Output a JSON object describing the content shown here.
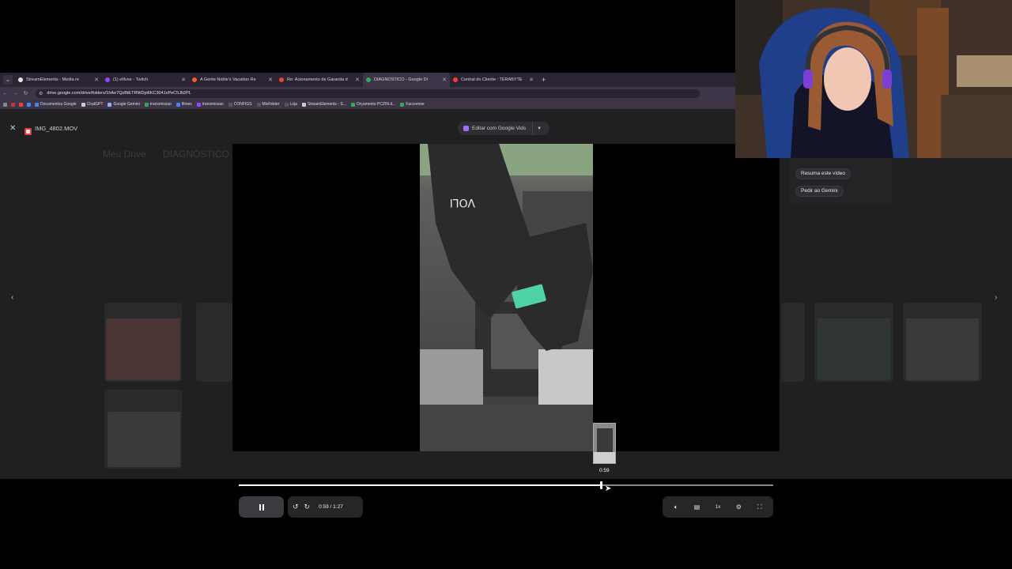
{
  "browser": {
    "tabs": [
      {
        "title": "StreamElements - Media re",
        "color": "#e5e5e5",
        "active": false
      },
      {
        "title": "(1) elllvee - Twitch",
        "color": "#9146ff",
        "active": false
      },
      {
        "title": "A Gente Noble's Vacation Re",
        "color": "#ff5722",
        "active": false
      },
      {
        "title": "Re: Acionamento de Garantia d",
        "color": "#ea4335",
        "active": false
      },
      {
        "title": "DIAGNÓSTICO - Google Dr",
        "color": "#34a853",
        "active": true
      },
      {
        "title": "Central do Cliente : TERABYTE",
        "color": "#ff3b30",
        "active": false
      }
    ],
    "url": "drive.google.com/drive/folders/1hAe7QzBtETRWDpi6KC3041xPeC5Jb2PL",
    "bookmarks": [
      {
        "label": "Documentos Google",
        "color": "#4285f4"
      },
      {
        "label": "ChatGPT",
        "color": "#cccccc"
      },
      {
        "label": "Google Gemini",
        "color": "#8ab4f8"
      },
      {
        "label": "transmissao",
        "color": "#34a853"
      },
      {
        "label": "filmes",
        "color": "#4285f4"
      },
      {
        "label": "transmissao",
        "color": "#9146ff"
      },
      {
        "label": "CONFIGS",
        "color": "#555555"
      },
      {
        "label": "MixFekter",
        "color": "#555555"
      },
      {
        "label": "Loja",
        "color": "#555555"
      },
      {
        "label": "StreamElements - S...",
        "color": "#cccccc"
      },
      {
        "label": "Orçamento PCZIN d...",
        "color": "#34a853"
      },
      {
        "label": "Faccomoe",
        "color": "#34a853"
      }
    ]
  },
  "drive_background": {
    "breadcrumb_root": "Meu Drive",
    "breadcrumb_folder": "DIAGNÓSTICO"
  },
  "viewer": {
    "file_name": "IMG_4802.MOV",
    "edit_button_label": "Editar com Google Vids"
  },
  "gemini": {
    "summarize_label": "Resuma este vídeo",
    "ask_label": "Pedir ao Gemini"
  },
  "player": {
    "current_time": "0:59",
    "duration": "1:27",
    "time_display": "0:59 / 1:27",
    "preview_time": "0:59",
    "progress_fraction": 0.678,
    "speed_label": "1x"
  }
}
